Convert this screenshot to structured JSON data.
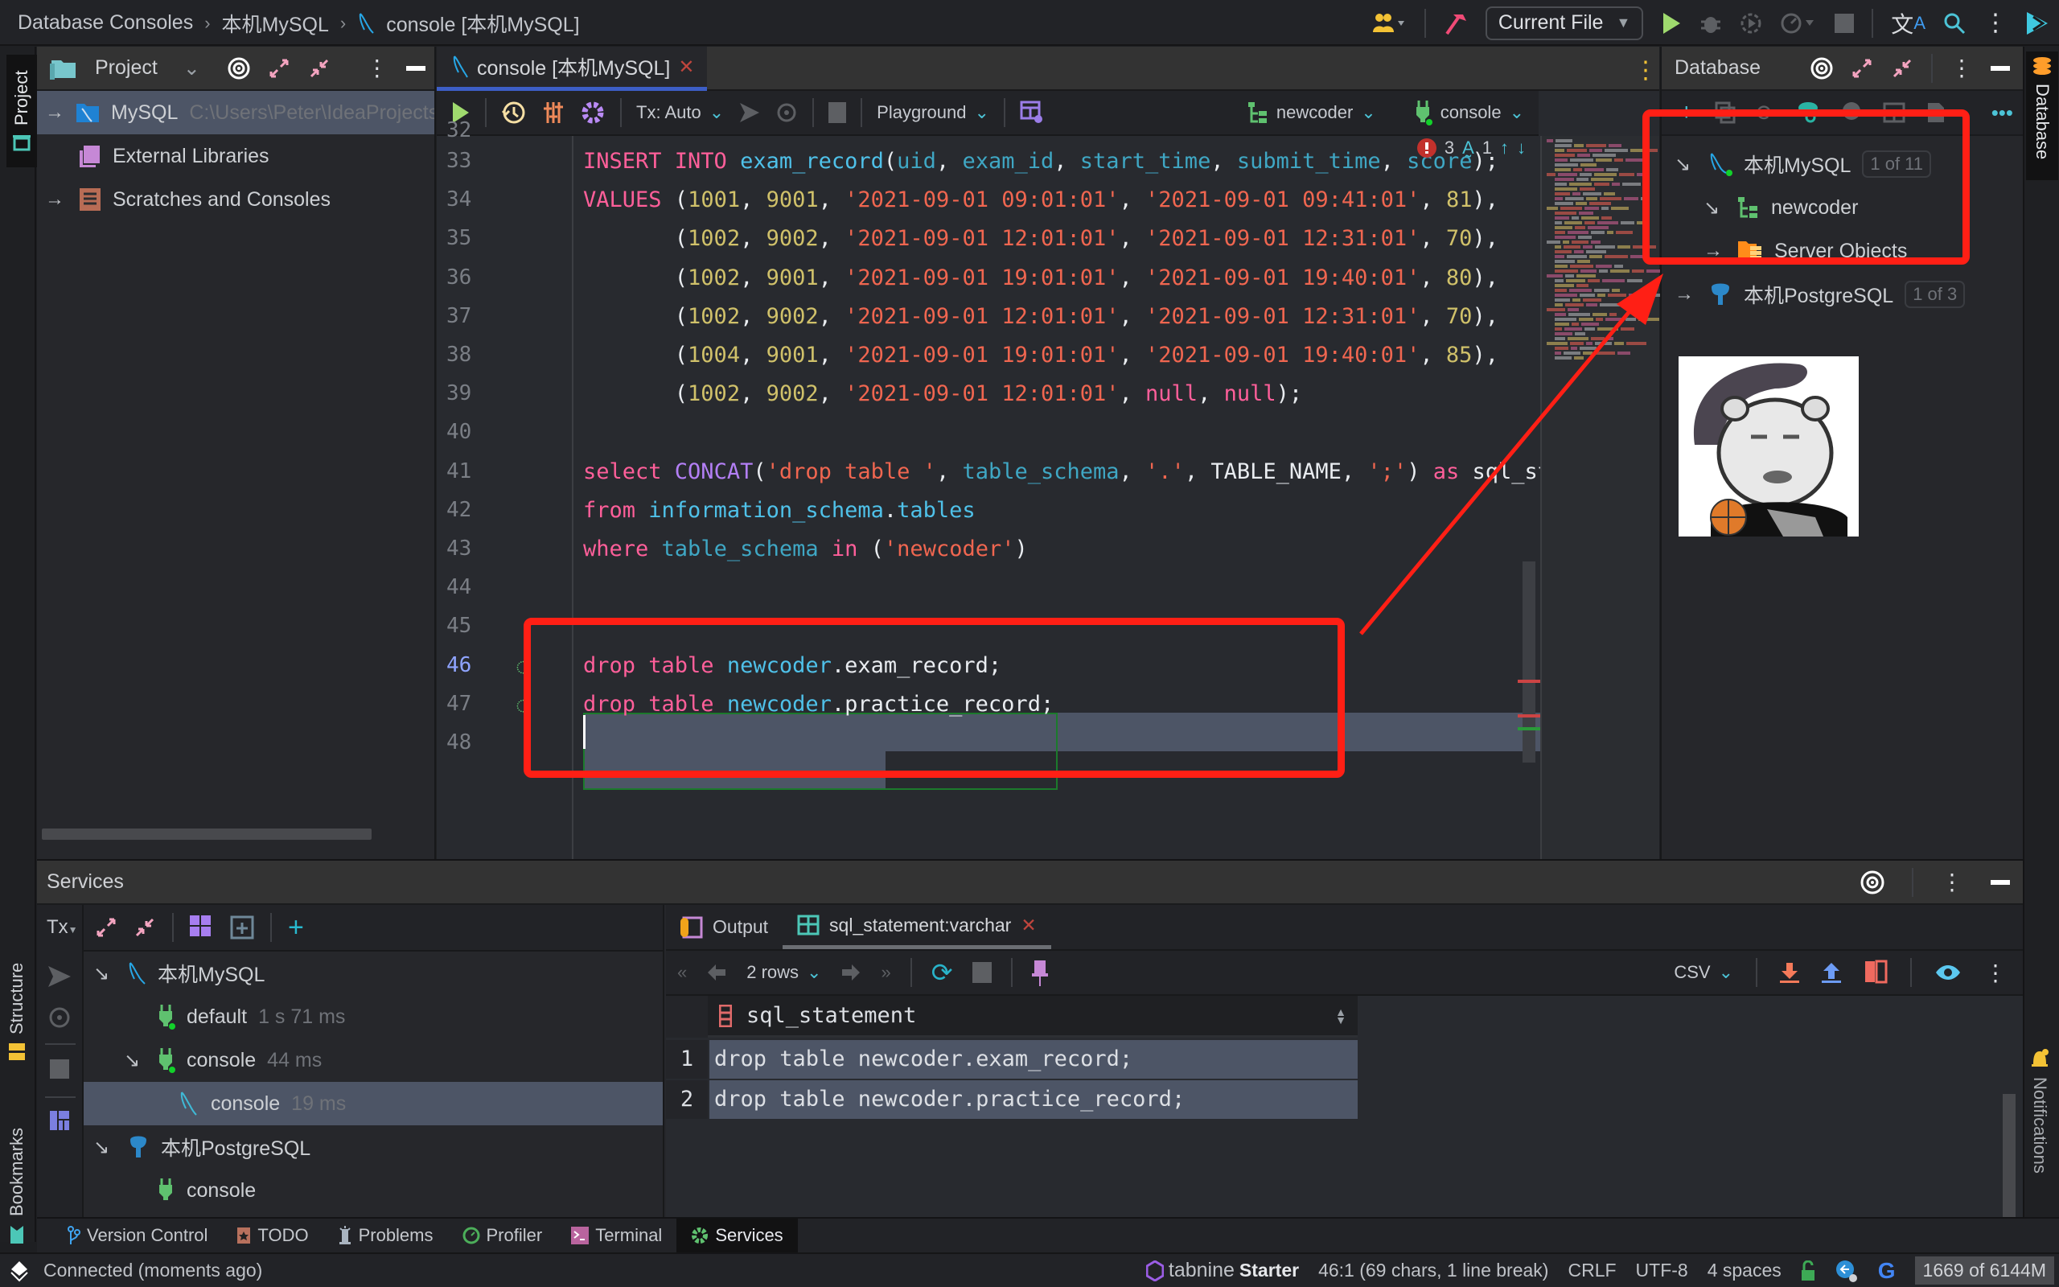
{
  "titlebar": {
    "breadcrumb": [
      "Database Consoles",
      "本机MySQL",
      "console [本机MySQL]"
    ],
    "run_config": "Current File"
  },
  "left_stripe": {
    "project": "Project",
    "structure": "Structure",
    "bookmarks": "Bookmarks"
  },
  "right_stripe": {
    "database": "Database",
    "notifications": "Notifications"
  },
  "project": {
    "title": "Project",
    "items": [
      {
        "label": "MySQL",
        "path": "C:\\Users\\Peter\\IdeaProjects",
        "selected": true
      },
      {
        "label": "External Libraries"
      },
      {
        "label": "Scratches and Consoles"
      }
    ]
  },
  "editor": {
    "tab_label": "console [本机MySQL]",
    "toolbar": {
      "tx": "Tx: Auto",
      "playground": "Playground",
      "schema": "newcoder",
      "session": "console"
    },
    "inspections": {
      "errors": "3",
      "typos": "1"
    },
    "partial_line_number": "32",
    "lines": [
      {
        "n": "33",
        "tokens": [
          [
            "kw",
            "INSERT INTO "
          ],
          [
            "id",
            "exam_record"
          ],
          [
            "w",
            "("
          ],
          [
            "col",
            "uid"
          ],
          [
            "w",
            ", "
          ],
          [
            "col",
            "exam_id"
          ],
          [
            "w",
            ", "
          ],
          [
            "col",
            "start_time"
          ],
          [
            "w",
            ", "
          ],
          [
            "col",
            "submit_time"
          ],
          [
            "w",
            ", "
          ],
          [
            "col",
            "score"
          ],
          [
            "w",
            ");"
          ]
        ]
      },
      {
        "n": "34",
        "tokens": [
          [
            "kw",
            "VALUES "
          ],
          [
            "w",
            "("
          ],
          [
            "num",
            "1001"
          ],
          [
            "w",
            ", "
          ],
          [
            "num",
            "9001"
          ],
          [
            "w",
            ", "
          ],
          [
            "str",
            "'2021-09-01 09:01:01'"
          ],
          [
            "w",
            ", "
          ],
          [
            "str",
            "'2021-09-01 09:41:01'"
          ],
          [
            "w",
            ", "
          ],
          [
            "num",
            "81"
          ],
          [
            "w",
            "),"
          ]
        ]
      },
      {
        "n": "35",
        "tokens": [
          [
            "w",
            "       ("
          ],
          [
            "num",
            "1002"
          ],
          [
            "w",
            ", "
          ],
          [
            "num",
            "9002"
          ],
          [
            "w",
            ", "
          ],
          [
            "str",
            "'2021-09-01 12:01:01'"
          ],
          [
            "w",
            ", "
          ],
          [
            "str",
            "'2021-09-01 12:31:01'"
          ],
          [
            "w",
            ", "
          ],
          [
            "num",
            "70"
          ],
          [
            "w",
            "),"
          ]
        ]
      },
      {
        "n": "36",
        "tokens": [
          [
            "w",
            "       ("
          ],
          [
            "num",
            "1002"
          ],
          [
            "w",
            ", "
          ],
          [
            "num",
            "9001"
          ],
          [
            "w",
            ", "
          ],
          [
            "str",
            "'2021-09-01 19:01:01'"
          ],
          [
            "w",
            ", "
          ],
          [
            "str",
            "'2021-09-01 19:40:01'"
          ],
          [
            "w",
            ", "
          ],
          [
            "num",
            "80"
          ],
          [
            "w",
            "),"
          ]
        ]
      },
      {
        "n": "37",
        "tokens": [
          [
            "w",
            "       ("
          ],
          [
            "num",
            "1002"
          ],
          [
            "w",
            ", "
          ],
          [
            "num",
            "9002"
          ],
          [
            "w",
            ", "
          ],
          [
            "str",
            "'2021-09-01 12:01:01'"
          ],
          [
            "w",
            ", "
          ],
          [
            "str",
            "'2021-09-01 12:31:01'"
          ],
          [
            "w",
            ", "
          ],
          [
            "num",
            "70"
          ],
          [
            "w",
            "),"
          ]
        ]
      },
      {
        "n": "38",
        "tokens": [
          [
            "w",
            "       ("
          ],
          [
            "num",
            "1004"
          ],
          [
            "w",
            ", "
          ],
          [
            "num",
            "9001"
          ],
          [
            "w",
            ", "
          ],
          [
            "str",
            "'2021-09-01 19:01:01'"
          ],
          [
            "w",
            ", "
          ],
          [
            "str",
            "'2021-09-01 19:40:01'"
          ],
          [
            "w",
            ", "
          ],
          [
            "num",
            "85"
          ],
          [
            "w",
            "),"
          ]
        ]
      },
      {
        "n": "39",
        "tokens": [
          [
            "w",
            "       ("
          ],
          [
            "num",
            "1002"
          ],
          [
            "w",
            ", "
          ],
          [
            "num",
            "9002"
          ],
          [
            "w",
            ", "
          ],
          [
            "str",
            "'2021-09-01 12:01:01'"
          ],
          [
            "w",
            ", "
          ],
          [
            "kw",
            "null"
          ],
          [
            "w",
            ", "
          ],
          [
            "kw",
            "null"
          ],
          [
            "w",
            ");"
          ]
        ]
      },
      {
        "n": "40",
        "tokens": []
      },
      {
        "n": "41",
        "tokens": [
          [
            "kw",
            "select "
          ],
          [
            "fn",
            "CONCAT"
          ],
          [
            "w",
            "("
          ],
          [
            "str",
            "'drop table '"
          ],
          [
            "w",
            ", "
          ],
          [
            "col",
            "table_schema"
          ],
          [
            "w",
            ", "
          ],
          [
            "str",
            "'.'"
          ],
          [
            "w",
            ", "
          ],
          [
            "w",
            "TABLE_NAME"
          ],
          [
            "w",
            ", "
          ],
          [
            "str",
            "';'"
          ],
          [
            "w",
            ") "
          ],
          [
            "kw",
            "as "
          ],
          [
            "w",
            "sql_statement"
          ]
        ]
      },
      {
        "n": "42",
        "tokens": [
          [
            "kw",
            "from "
          ],
          [
            "id",
            "information_schema"
          ],
          [
            "w",
            "."
          ],
          [
            "id",
            "tables"
          ]
        ]
      },
      {
        "n": "43",
        "tokens": [
          [
            "kw",
            "where "
          ],
          [
            "col",
            "table_schema "
          ],
          [
            "kw",
            "in "
          ],
          [
            "w",
            "("
          ],
          [
            "str",
            "'newcoder'"
          ],
          [
            "w",
            ")"
          ]
        ]
      },
      {
        "n": "44",
        "tokens": []
      },
      {
        "n": "45",
        "tokens": []
      },
      {
        "n": "46",
        "tokens": [
          [
            "kw",
            "drop table "
          ],
          [
            "id",
            "newcoder"
          ],
          [
            "w",
            ".exam_record;"
          ]
        ]
      },
      {
        "n": "47",
        "tokens": [
          [
            "kw",
            "drop table "
          ],
          [
            "id",
            "newcoder"
          ],
          [
            "w",
            ".practice_record;"
          ]
        ]
      },
      {
        "n": "48",
        "tokens": []
      }
    ]
  },
  "database": {
    "title": "Database",
    "tree": [
      {
        "label": "本机MySQL",
        "badge": "1 of 11"
      },
      {
        "label": "newcoder"
      },
      {
        "label": "Server Objects"
      },
      {
        "label": "本机PostgreSQL",
        "badge": "1 of 3"
      }
    ]
  },
  "services": {
    "title": "Services",
    "tx": "Tx",
    "tree": [
      {
        "label": "本机MySQL",
        "time": ""
      },
      {
        "label": "default",
        "time": "1 s 71 ms"
      },
      {
        "label": "console",
        "time": "44 ms"
      },
      {
        "label": "console",
        "time": "19 ms"
      },
      {
        "label": "本机PostgreSQL",
        "time": ""
      },
      {
        "label": "console",
        "time": ""
      }
    ],
    "results": {
      "tabs": [
        "Output",
        "sql_statement:varchar"
      ],
      "rows_label": "2 rows",
      "export_format": "CSV",
      "column": "sql_statement",
      "rows": [
        {
          "n": "1",
          "value": "drop table newcoder.exam_record;"
        },
        {
          "n": "2",
          "value": "drop table newcoder.practice_record;"
        }
      ]
    }
  },
  "tool_tabs": [
    "Version Control",
    "TODO",
    "Problems",
    "Profiler",
    "Terminal",
    "Services"
  ],
  "status": {
    "message": "Connected (moments ago)",
    "tabnine": "tabnine",
    "tabnine_plan": "Starter",
    "caret": "46:1 (69 chars, 1 line break)",
    "line_sep": "CRLF",
    "encoding": "UTF-8",
    "indent": "4 spaces",
    "memory": "1669 of 6144M"
  },
  "colors": {
    "accent": "#3d5ec6",
    "annotation": "#ff1f15",
    "selection": "#4d5566"
  }
}
